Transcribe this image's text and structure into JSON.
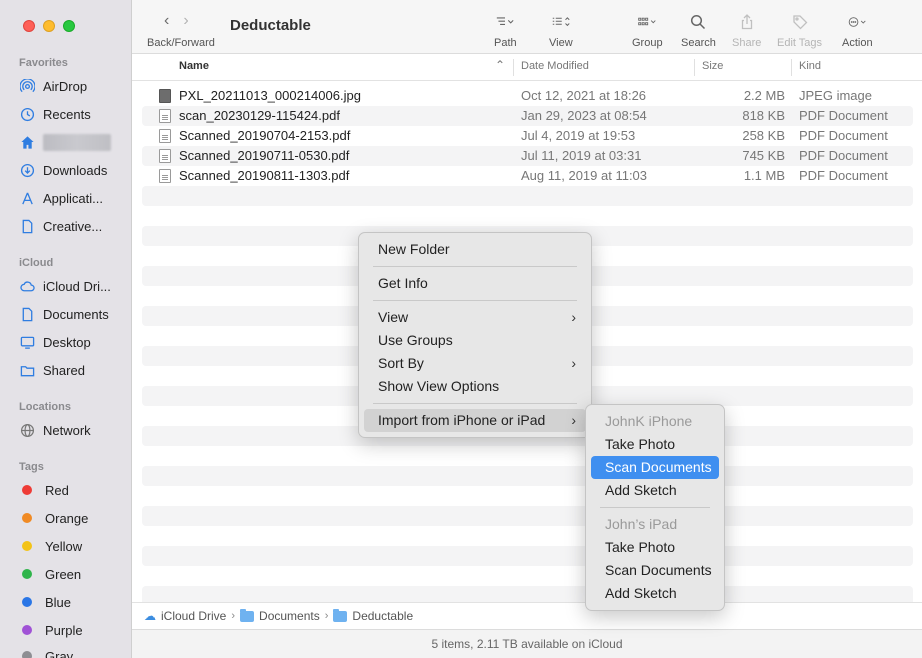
{
  "window": {
    "title": "Deductable"
  },
  "toolbar": {
    "nav_label": "Back/Forward",
    "path": "Path",
    "view": "View",
    "group": "Group",
    "search": "Search",
    "share": "Share",
    "edit_tags": "Edit Tags",
    "action": "Action"
  },
  "sidebar": {
    "favorites_title": "Favorites",
    "favorites": [
      {
        "label": "AirDrop",
        "icon": "airdrop-icon"
      },
      {
        "label": "Recents",
        "icon": "clock-icon"
      },
      {
        "label": "",
        "icon": "home-icon"
      },
      {
        "label": "Downloads",
        "icon": "download-icon"
      },
      {
        "label": "Applicati...",
        "icon": "applications-icon"
      },
      {
        "label": "Creative...",
        "icon": "document-icon"
      }
    ],
    "icloud_title": "iCloud",
    "icloud": [
      {
        "label": "iCloud Dri...",
        "icon": "cloud-icon"
      },
      {
        "label": "Documents",
        "icon": "document-icon"
      },
      {
        "label": "Desktop",
        "icon": "desktop-icon"
      },
      {
        "label": "Shared",
        "icon": "shared-folder-icon"
      }
    ],
    "locations_title": "Locations",
    "locations": [
      {
        "label": "Network",
        "icon": "globe-icon"
      }
    ],
    "tags_title": "Tags",
    "tags": [
      {
        "label": "Red",
        "color": "#ee3b36"
      },
      {
        "label": "Orange",
        "color": "#f08a24"
      },
      {
        "label": "Yellow",
        "color": "#f3c317"
      },
      {
        "label": "Green",
        "color": "#2fb44b"
      },
      {
        "label": "Blue",
        "color": "#2a76e6"
      },
      {
        "label": "Purple",
        "color": "#a052d6"
      },
      {
        "label": "Gray",
        "color": "#8e8e93"
      }
    ]
  },
  "columns": {
    "name": "Name",
    "date": "Date Modified",
    "size": "Size",
    "kind": "Kind"
  },
  "files": [
    {
      "name": "PXL_20211013_000214006.jpg",
      "date": "Oct 12, 2021 at 18:26",
      "size": "2.2 MB",
      "kind": "JPEG image",
      "type": "img"
    },
    {
      "name": "scan_20230129-115424.pdf",
      "date": "Jan 29, 2023 at 08:54",
      "size": "818 KB",
      "kind": "PDF Document",
      "type": "pdf"
    },
    {
      "name": "Scanned_20190704-2153.pdf",
      "date": "Jul 4, 2019 at 19:53",
      "size": "258 KB",
      "kind": "PDF Document",
      "type": "pdf"
    },
    {
      "name": "Scanned_20190711-0530.pdf",
      "date": "Jul 11, 2019 at 03:31",
      "size": "745 KB",
      "kind": "PDF Document",
      "type": "pdf"
    },
    {
      "name": "Scanned_20190811-1303.pdf",
      "date": "Aug 11, 2019 at 11:03",
      "size": "1.1 MB",
      "kind": "PDF Document",
      "type": "pdf"
    }
  ],
  "pathbar": {
    "crumbs": [
      "iCloud Drive",
      "Documents",
      "Deductable"
    ]
  },
  "status": "5 items, 2.11 TB available on iCloud",
  "context_menu": {
    "new_folder": "New Folder",
    "get_info": "Get Info",
    "view": "View",
    "use_groups": "Use Groups",
    "sort_by": "Sort By",
    "show_view_options": "Show View Options",
    "import": "Import from iPhone or iPad"
  },
  "submenu": {
    "device1": "JohnK iPhone",
    "device1_items": [
      "Take Photo",
      "Scan Documents",
      "Add Sketch"
    ],
    "device2": "John’s iPad",
    "device2_items": [
      "Take Photo",
      "Scan Documents",
      "Add Sketch"
    ],
    "highlighted": "Scan Documents"
  }
}
